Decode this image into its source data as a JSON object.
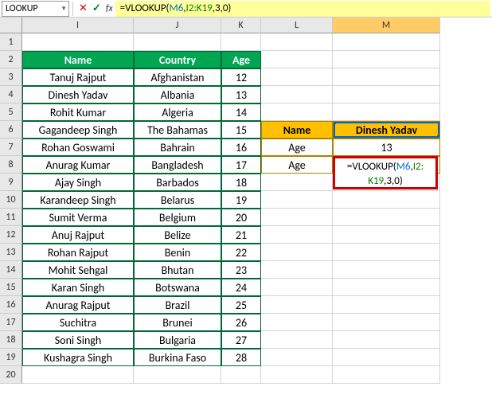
{
  "nameBox": "LOOKUP",
  "formulaBar": {
    "full": "=VLOOKUP(M6,I2:K19,3,0)",
    "eq": "=VLOOKUP(",
    "arg1": "M6",
    "c1": ",",
    "arg2": "I2:K19",
    "c2": ",3,0)"
  },
  "cols": [
    "I",
    "J",
    "K",
    "L",
    "M"
  ],
  "rowNums": [
    1,
    2,
    3,
    4,
    5,
    6,
    7,
    8,
    9,
    10,
    11,
    12,
    13,
    14,
    15,
    16,
    17,
    18,
    19,
    20
  ],
  "hdr": {
    "name": "Name",
    "country": "Country",
    "age": "Age"
  },
  "rows": [
    {
      "n": "Tanuj Rajput",
      "c": "Afghanistan",
      "a": "12"
    },
    {
      "n": "Dinesh Yadav",
      "c": "Albania",
      "a": "13"
    },
    {
      "n": "Rohit Kumar",
      "c": "Algeria",
      "a": "14"
    },
    {
      "n": "Gagandeep Singh",
      "c": "The Bahamas",
      "a": "15"
    },
    {
      "n": "Rohan Goswami",
      "c": "Bahrain",
      "a": "16"
    },
    {
      "n": "Anurag Kumar",
      "c": "Bangladesh",
      "a": "17"
    },
    {
      "n": "Ajay Singh",
      "c": "Barbados",
      "a": "18"
    },
    {
      "n": "Karandeep Singh",
      "c": "Belarus",
      "a": "19"
    },
    {
      "n": "Sumit Verma",
      "c": "Belgium",
      "a": "20"
    },
    {
      "n": "Anuj Rajput",
      "c": "Belize",
      "a": "21"
    },
    {
      "n": "Rohan Rajput",
      "c": "Benin",
      "a": "22"
    },
    {
      "n": "Mohit Sehgal",
      "c": "Bhutan",
      "a": "23"
    },
    {
      "n": "Karan Singh",
      "c": "Botswana",
      "a": "24"
    },
    {
      "n": "Anurag Rajput",
      "c": "Brazil",
      "a": "25"
    },
    {
      "n": "Suchitra",
      "c": "Brunei",
      "a": "26"
    },
    {
      "n": "Soni Singh",
      "c": "Bulgaria",
      "a": "27"
    },
    {
      "n": "Kushagra Singh",
      "c": "Burkina Faso",
      "a": "28"
    }
  ],
  "side": {
    "L6": "Name",
    "M6": "Dinesh Yadav",
    "L7": "Age",
    "M7": "13",
    "L8": "Age"
  },
  "editing": {
    "line1_eq": "=VLOOKUP(",
    "line1_a": "M6",
    "line1_c": ",",
    "line1_b": "I2:",
    "line2_b": "K19",
    "line2_c": ",3,0)"
  }
}
